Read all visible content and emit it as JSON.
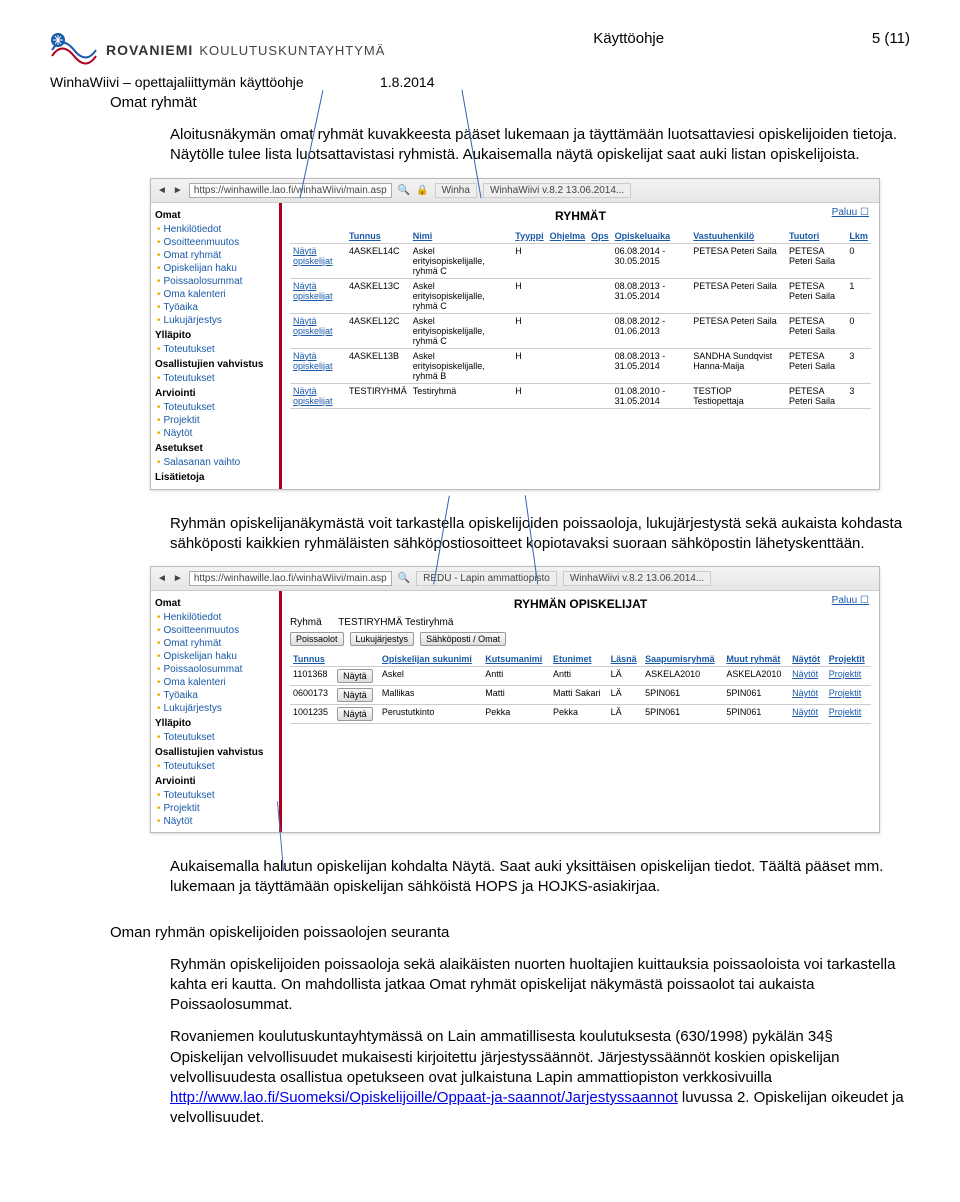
{
  "header": {
    "org1": "ROVANIEMI",
    "org2": "KOULUTUSKUNTAYHTYMÄ",
    "title": "Käyttöohje",
    "page": "5 (11)",
    "sub_left": "WinhaWiivi – opettajaliittymän käyttöohje",
    "sub_date": "1.8.2014"
  },
  "section1": {
    "title": "Omat ryhmät",
    "p1": "Aloitusnäkymän omat ryhmät kuvakkeesta pääset lukemaan ja täyttämään luotsattaviesi opiskelijoiden tietoja. Näytölle tulee lista luotsattavistasi ryhmistä. Aukaisemalla näytä opiskelijat saat auki listan opiskelijoista."
  },
  "screenshot1": {
    "url": "https://winhawille.lao.fi/winhaWiivi/main.asp",
    "tab1": "Winha",
    "tab2": "WinhaWiivi v.8.2 13.06.2014...",
    "main_title": "RYHMÄT",
    "paluu": "Paluu",
    "sidebar_cats": {
      "omat": "Omat",
      "yllapito": "Ylläpito",
      "osall": "Osallistujien vahvistus",
      "arviointi": "Arviointi",
      "asetukset": "Asetukset",
      "lisat": "Lisätietoja"
    },
    "sidebar_items": {
      "henk": "Henkilötiedot",
      "osoite": "Osoitteenmuutos",
      "omatr": "Omat ryhmät",
      "ophaku": "Opiskelijan haku",
      "poissa": "Poissaolosummat",
      "kalenteri": "Oma kalenteri",
      "tyoaika": "Työaika",
      "lukuj": "Lukujärjestys",
      "toteut": "Toteutukset",
      "toteut2": "Toteutukset",
      "toteut3": "Toteutukset",
      "projektit": "Projektit",
      "naytot": "Näytöt",
      "salasana": "Salasanan vaihto"
    },
    "cols": {
      "tunnus": "Tunnus",
      "nimi": "Nimi",
      "tyyppi": "Tyyppi",
      "ohjelma": "Ohjelma",
      "ops": "Ops",
      "opiskeluaika": "Opiskeluaika",
      "vastuu": "Vastuuhenkilö",
      "tuutori": "Tuutori",
      "lkm": "Lkm"
    },
    "nayta_op": "Näytä opiskelijat",
    "rows": [
      {
        "t": "4ASKEL14C",
        "n": "Askel erityisopiskelijalle, ryhmä C",
        "ty": "H",
        "aika": "06.08.2014 - 30.05.2015",
        "v": "PETESA Peteri Saila",
        "tu": "PETESA Peteri Saila",
        "l": "0"
      },
      {
        "t": "4ASKEL13C",
        "n": "Askel erityisopiskelijalle, ryhmä C",
        "ty": "H",
        "aika": "08.08.2013 - 31.05.2014",
        "v": "PETESA Peteri Saila",
        "tu": "PETESA Peteri Saila",
        "l": "1"
      },
      {
        "t": "4ASKEL12C",
        "n": "Askel erityisopiskelijalle, ryhmä C",
        "ty": "H",
        "aika": "08.08.2012 - 01.06.2013",
        "v": "PETESA Peteri Saila",
        "tu": "PETESA Peteri Saila",
        "l": "0"
      },
      {
        "t": "4ASKEL13B",
        "n": "Askel erityisopiskelijalle, ryhmä B",
        "ty": "H",
        "aika": "08.08.2013 - 31.05.2014",
        "v": "SANDHA Sundqvist Hanna-Maija",
        "tu": "PETESA Peteri Saila",
        "l": "3"
      },
      {
        "t": "TESTIRYHMÄ",
        "n": "Testiryhmä",
        "ty": "H",
        "aika": "01.08.2010 - 31.05.2014",
        "v": "TESTIOP Testiopettaja",
        "tu": "PETESA Peteri Saila",
        "l": "3"
      }
    ]
  },
  "section2": {
    "p1": "Ryhmän opiskelijanäkymästä voit tarkastella opiskelijoiden poissaoloja, lukujärjestystä sekä aukaista kohdasta sähköposti kaikkien ryhmäläisten sähköpostiosoitteet kopiotavaksi suoraan sähköpostin lähetyskenttään."
  },
  "screenshot2": {
    "url": "https://winhawille.lao.fi/winhaWiivi/main.asp",
    "tab1": "REDU - Lapin ammattiopisto",
    "tab2": "WinhaWiivi v.8.2 13.06.2014...",
    "main_title": "RYHMÄN OPISKELIJAT",
    "ryhma_lbl": "Ryhmä",
    "ryhma_val": "TESTIRYHMÄ Testiryhmä",
    "paluu": "Paluu",
    "btn_poissa": "Poissaolot",
    "btn_luku": "Lukujärjestys",
    "btn_sahko": "Sähköposti / Omat",
    "btn_nayta": "Näytä",
    "cols": {
      "tunnus": "Tunnus",
      "suku": "Opiskelijan sukunimi",
      "kutsu": "Kutsumanimi",
      "etu": "Etunimet",
      "lasna": "Läsnä",
      "sr": "Saapumisryhmä",
      "mr": "Muut ryhmät",
      "nayt": "Näytöt",
      "proj": "Projektit"
    },
    "link_naytot": "Näytöt",
    "link_proj": "Projektit",
    "rows": [
      {
        "t": "1101368",
        "s": "Askel",
        "k": "Antti",
        "e": "Antti",
        "l": "LÄ",
        "sr": "ASKELA2010",
        "mr": "ASKELA2010"
      },
      {
        "t": "0600173",
        "s": "Mallikas",
        "k": "Matti",
        "e": "Matti Sakari",
        "l": "LÄ",
        "sr": "5PIN061",
        "mr": "5PIN061"
      },
      {
        "t": "1001235",
        "s": "Perustutkinto",
        "k": "Pekka",
        "e": "Pekka",
        "l": "LÄ",
        "sr": "5PIN061",
        "mr": "5PIN061"
      }
    ]
  },
  "section3": {
    "p1": "Aukaisemalla halutun opiskelijan kohdalta Näytä. Saat auki yksittäisen opiskelijan tiedot. Täältä pääset mm. lukemaan ja täyttämään opiskelijan sähköistä HOPS ja HOJKS-asiakirjaa."
  },
  "section4": {
    "title": "Oman ryhmän opiskelijoiden poissaolojen seuranta",
    "p1": "Ryhmän opiskelijoiden poissaoloja sekä alaikäisten nuorten huoltajien kuittauksia poissaoloista voi tarkastella kahta eri kautta. On mahdollista jatkaa Omat ryhmät opiskelijat näkymästä poissaolot tai aukaista Poissaolosummat.",
    "p2a": "Rovaniemen koulutuskuntayhtymässä on Lain ammatillisesta koulutuksesta (630/1998) pykälän 34§ Opiskelijan velvollisuudet mukaisesti kirjoitettu järjestyssäännöt. Järjestyssäännöt koskien opiskelijan velvollisuudesta osallistua opetukseen ovat julkaistuna Lapin ammattiopiston verkkosivuilla",
    "link": "http://www.lao.fi/Suomeksi/Opiskelijoille/Oppaat-ja-saannot/Jarjestyssaannot",
    "p2b": " luvussa 2. Opiskelijan oikeudet ja velvollisuudet."
  }
}
